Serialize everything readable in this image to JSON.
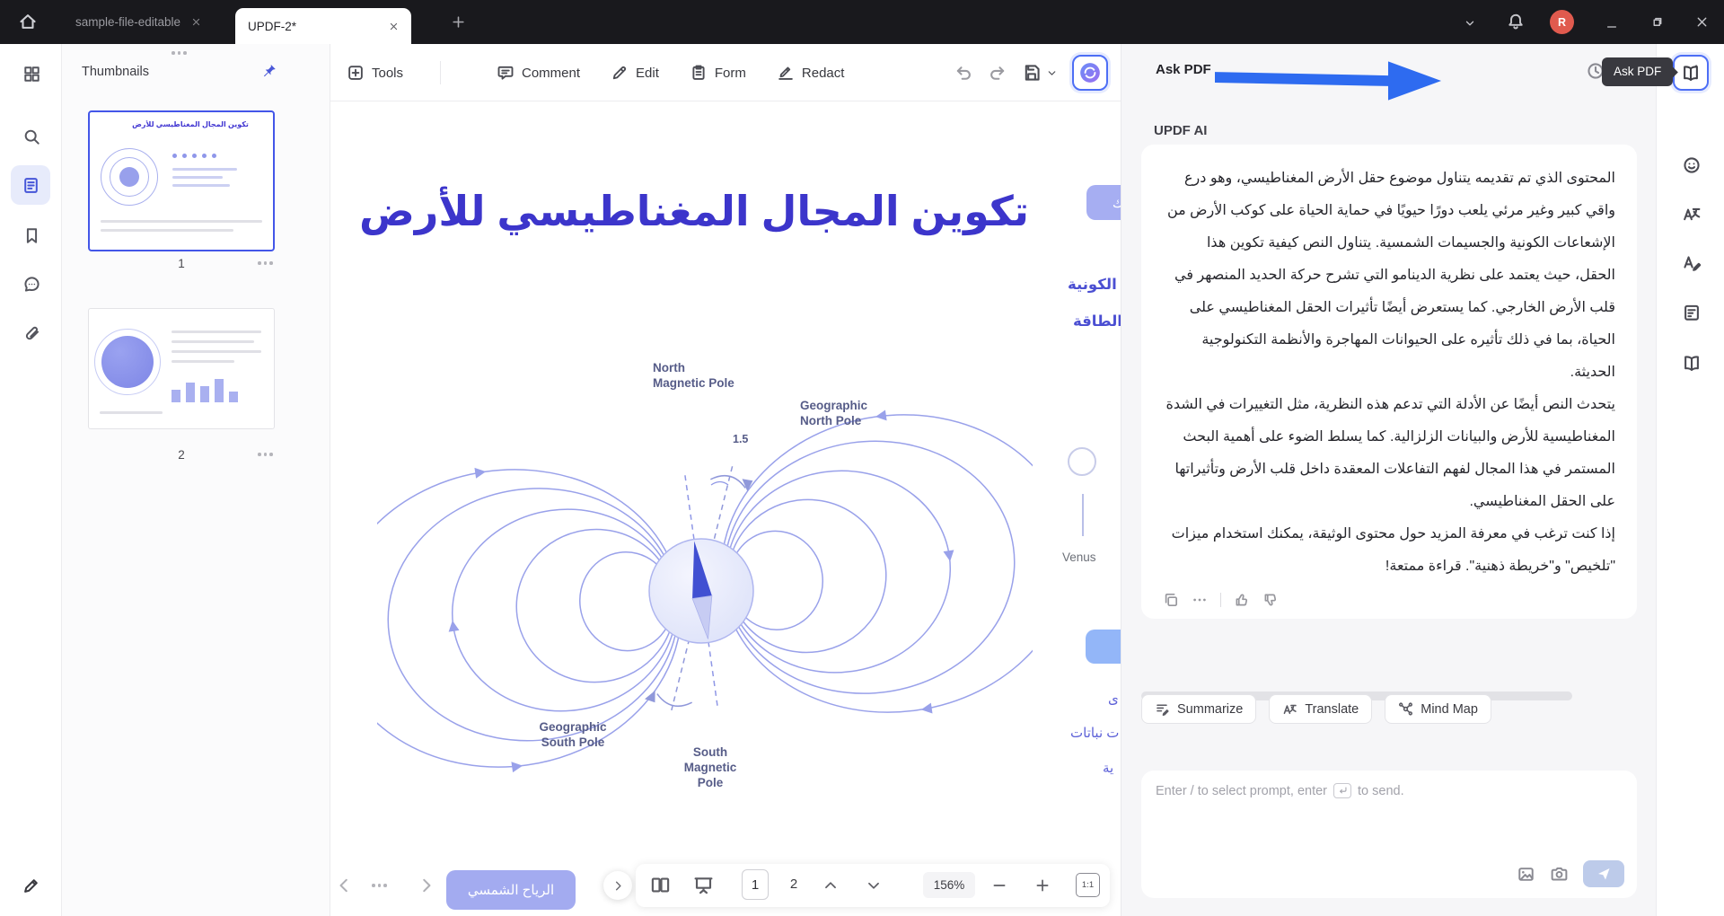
{
  "titlebar": {
    "tabs": [
      {
        "label": "sample-file-editable"
      },
      {
        "label": "UPDF-2*"
      }
    ],
    "avatar_letter": "R"
  },
  "thumbs": {
    "header": "Thumbnails",
    "page1": "1",
    "page2": "2"
  },
  "toolbar": {
    "tools": "Tools",
    "comment": "Comment",
    "edit": "Edit",
    "form": "Form",
    "redact": "Redact"
  },
  "askpdf": {
    "label": "Ask PDF",
    "tooltip": "Ask PDF"
  },
  "pdf": {
    "title": "تكوين المجال المغناطيسي للأرض",
    "labels": {
      "north_magnetic": "North\nMagnetic Pole",
      "geographic_north": "Geographic\nNorth Pole",
      "angle": "1.5",
      "geographic_south": "Geographic\nSouth Pole",
      "south_magnetic": "South\nMagnetic\nPole",
      "venus": "Venus"
    },
    "edge": {
      "partial_top": "ك",
      "word1": "الكونية",
      "word2": "الطاقة",
      "partial_a": "ى",
      "partial_b": "ت نباتات",
      "partial_c": "ية"
    },
    "solar_wind": "الرياح الشمسي"
  },
  "ai": {
    "title": "UPDF AI",
    "p1": "المحتوى الذي تم تقديمه يتناول موضوع حقل الأرض المغناطيسي، وهو درع واقي كبير وغير مرئي يلعب دورًا حيويًا في حماية الحياة على كوكب الأرض من الإشعاعات الكونية والجسيمات الشمسية. يتناول النص كيفية تكوين هذا الحقل، حيث يعتمد على نظرية الدينامو التي تشرح حركة الحديد المنصهر في قلب الأرض الخارجي. كما يستعرض أيضًا تأثيرات الحقل المغناطيسي على الحياة، بما في ذلك تأثيره على الحيوانات المهاجرة والأنظمة التكنولوجية الحديثة.",
    "p2": "يتحدث النص أيضًا عن الأدلة التي تدعم هذه النظرية، مثل التغييرات في الشدة المغناطيسية للأرض والبيانات الزلزالية. كما يسلط الضوء على أهمية البحث المستمر في هذا المجال لفهم التفاعلات المعقدة داخل قلب الأرض وتأثيراتها على الحقل المغناطيسي.",
    "p3": "إذا كنت ترغب في معرفة المزيد حول محتوى الوثيقة، يمكنك استخدام ميزات \"تلخيص\" و\"خريطة ذهنية\". قراءة ممتعة!",
    "buttons": {
      "summarize": "Summarize",
      "translate": "Translate",
      "mindmap": "Mind Map"
    },
    "placeholder_prefix": "Enter / to select prompt, enter",
    "placeholder_suffix": "to send."
  },
  "status": {
    "page_current": "1",
    "page_next": "2",
    "zoom": "156%",
    "fit": "1:1"
  }
}
